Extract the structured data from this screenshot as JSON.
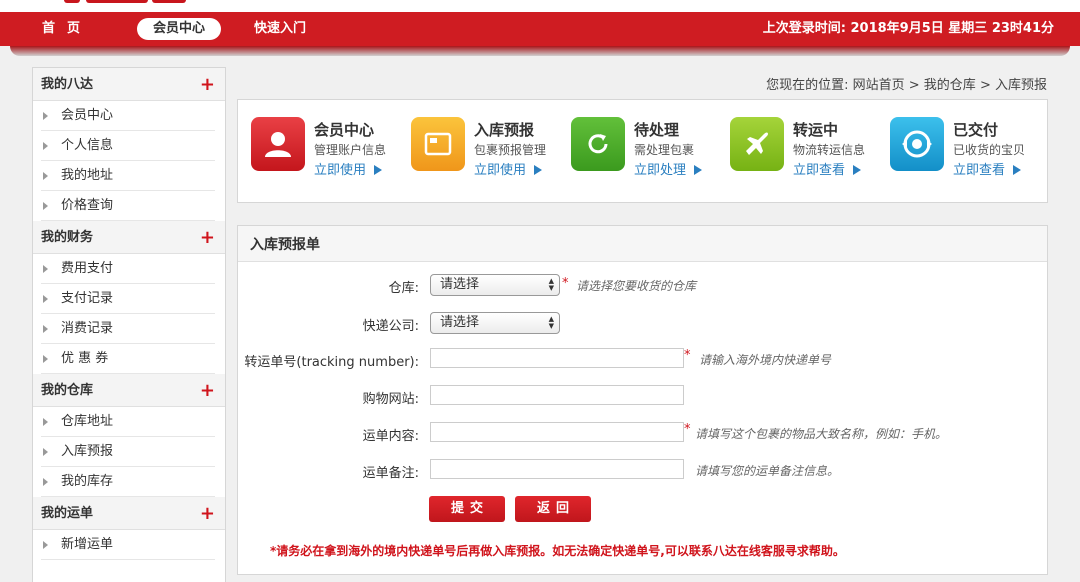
{
  "nav": {
    "home": "首页",
    "member_center": "会员中心",
    "quick_entry": "快速入门",
    "last_login": "上次登录时间: 2018年9月5日 星期三 23时41分"
  },
  "sidebar": {
    "groups": [
      {
        "title": "我的八达",
        "items": [
          "会员中心",
          "个人信息",
          "我的地址",
          "价格查询"
        ]
      },
      {
        "title": "我的财务",
        "items": [
          "费用支付",
          "支付记录",
          "消费记录",
          "优 惠 券"
        ]
      },
      {
        "title": "我的仓库",
        "items": [
          "仓库地址",
          "入库预报",
          "我的库存"
        ]
      },
      {
        "title": "我的运单",
        "items": [
          "新增运单"
        ]
      }
    ]
  },
  "breadcrumb": {
    "prefix": "您现在的位置: ",
    "home": "网站首页",
    "sep": " > ",
    "warehouse": "我的仓库",
    "current": "入库预报"
  },
  "cards": [
    {
      "title": "会员中心",
      "sub": "管理账户信息",
      "link": "立即使用",
      "color": "#d9262b"
    },
    {
      "title": "入库预报",
      "sub": "包裹预报管理",
      "link": "立即使用",
      "color": "#f5a51c"
    },
    {
      "title": "待处理",
      "sub": "需处理包裹",
      "link": "立即处理",
      "color": "#4ea82a"
    },
    {
      "title": "转运中",
      "sub": "物流转运信息",
      "link": "立即查看",
      "color": "#8cc220"
    },
    {
      "title": "已交付",
      "sub": "已收货的宝贝",
      "link": "立即查看",
      "color": "#1fa3d9"
    }
  ],
  "form": {
    "title": "入库预报单",
    "warehouse_label": "仓库:",
    "warehouse_value": "请选择",
    "warehouse_hint": "请选择您要收货的仓库",
    "courier_label": "快递公司:",
    "courier_value": "请选择",
    "tracking_label": "转运单号(tracking number):",
    "tracking_hint": "请输入海外境内快递单号",
    "site_label": "购物网站:",
    "content_label": "运单内容:",
    "content_hint": "请填写这个包裹的物品大致名称，例如：手机。",
    "remark_label": "运单备注:",
    "remark_hint": "请填写您的运单备注信息。",
    "submit": "提交",
    "back": "返回",
    "star": "*",
    "notice": "*请务必在拿到海外的境内快递单号后再做入库预报。如无法确定快递单号,可以联系八达在线客服寻求帮助。"
  },
  "colors": {
    "brand_red": "#cf1c22",
    "link_blue": "#2a7fc0"
  }
}
